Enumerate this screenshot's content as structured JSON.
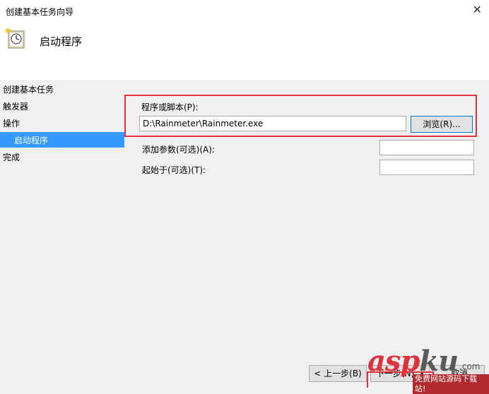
{
  "window": {
    "title": "创建基本任务向导",
    "close_glyph": "✕"
  },
  "header": {
    "title": "启动程序",
    "icon": "clock-task-icon"
  },
  "sidebar": {
    "items": [
      {
        "label": "创建基本任务"
      },
      {
        "label": "触发器"
      },
      {
        "label": "操作"
      },
      {
        "label": "启动程序",
        "selected": true
      },
      {
        "label": "完成"
      }
    ]
  },
  "form": {
    "program_label": "程序或脚本(P):",
    "program_value": "D:\\Rainmeter\\Rainmeter.exe",
    "browse_label": "浏览(R)...",
    "args_label": "添加参数(可选)(A):",
    "args_value": "",
    "start_in_label": "起始于(可选)(T):",
    "start_in_value": ""
  },
  "footer": {
    "back_label": "< 上一步(B)",
    "next_label": "下一步(N) >",
    "cancel_label": "取消"
  },
  "watermark": {
    "brand_asp": "asp",
    "brand_ku": "ku",
    "brand_suffix": ".com",
    "tagline": "免费网站源码下载站!"
  },
  "colors": {
    "highlight_box": "#e0323c",
    "selected": "#3399ff"
  }
}
